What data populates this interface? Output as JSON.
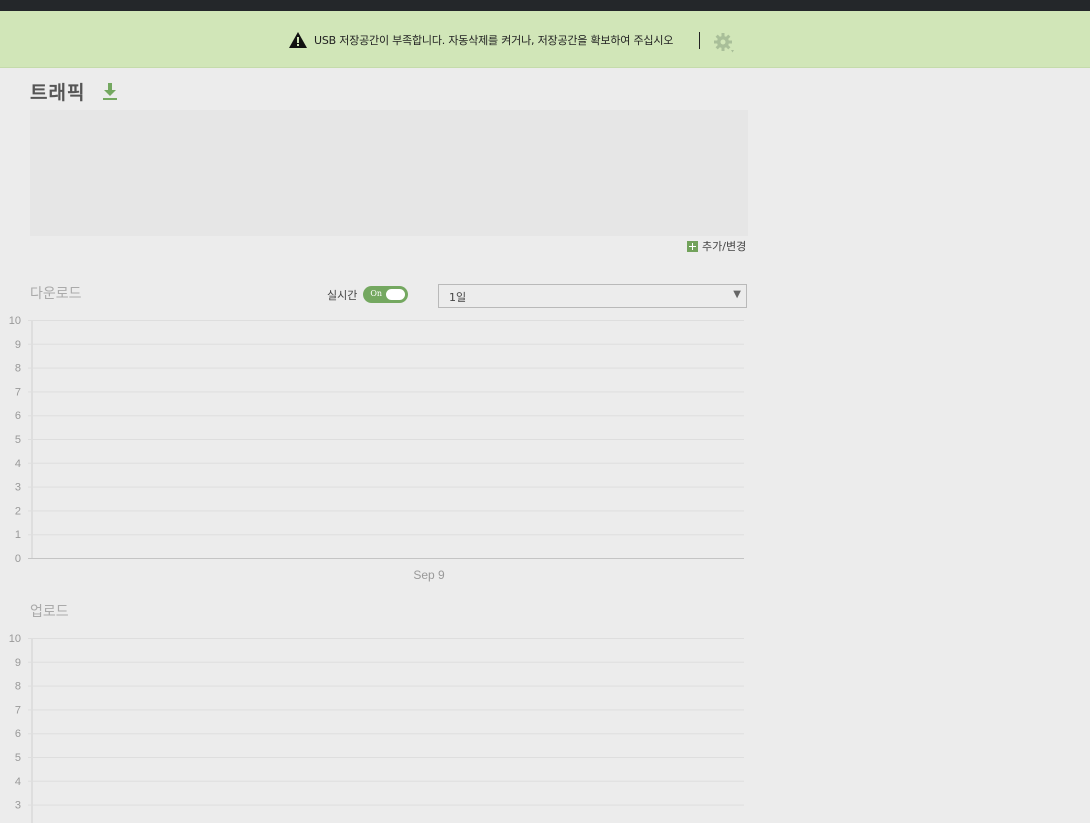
{
  "notice": {
    "text": "USB 저장공간이 부족합니다. 자동삭제를 켜거나, 저장공간을 확보하여 주십시오",
    "icon": "warning-icon",
    "settings_icon": "gear-icon"
  },
  "page": {
    "title": "트래픽",
    "download_icon": "download-icon"
  },
  "add_change": {
    "label": "추가/변경",
    "icon": "plus-icon"
  },
  "download_section": {
    "title": "다운로드",
    "realtime_label": "실시간",
    "toggle_label": "On",
    "period_value": "1일"
  },
  "upload_section": {
    "title": "업로드"
  },
  "colors": {
    "notice_bg": "#d1e6b8",
    "accent": "#74a860",
    "page_bg": "#ececec"
  },
  "chart_data": [
    {
      "type": "line",
      "title": "다운로드",
      "x_ticks": [
        "Sep 9"
      ],
      "ylim": [
        0,
        10
      ],
      "y_ticks": [
        0,
        1,
        2,
        3,
        4,
        5,
        6,
        7,
        8,
        9,
        10
      ],
      "series": [],
      "grid": true
    },
    {
      "type": "line",
      "title": "업로드",
      "ylim": [
        0,
        10
      ],
      "y_ticks": [
        3,
        4,
        5,
        6,
        7,
        8,
        9,
        10
      ],
      "series": [],
      "grid": true
    }
  ]
}
